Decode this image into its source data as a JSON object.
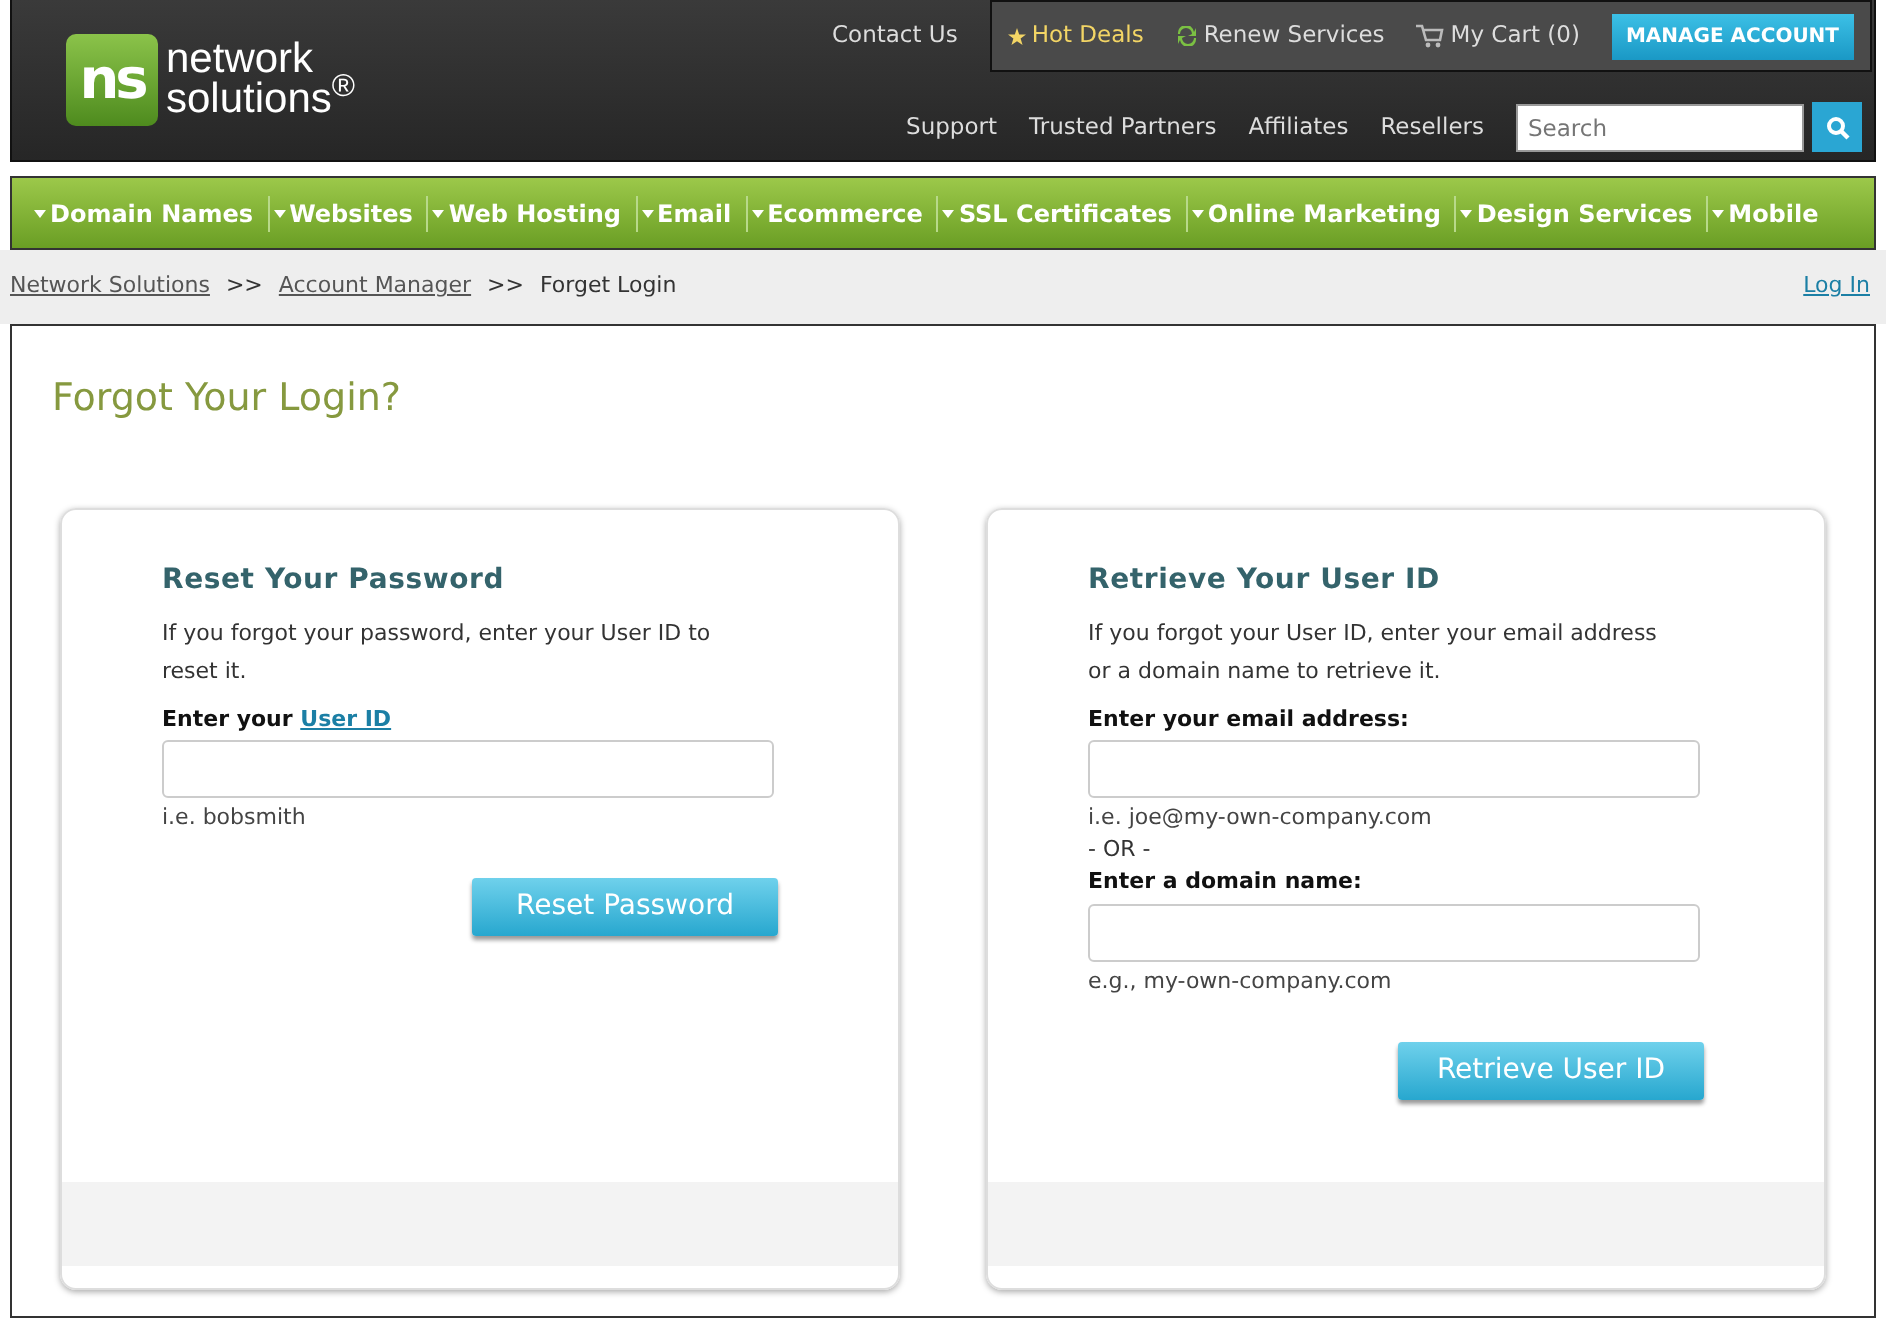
{
  "header": {
    "logo": {
      "monogram": "ns",
      "line1": "network",
      "line2": "solutions$^{®}$"
    },
    "contact": "Contact Us",
    "toolbar": [
      {
        "kind": "deals",
        "label": "Hot Deals"
      },
      {
        "kind": "renew",
        "label": "Renew Services"
      },
      {
        "kind": "cart",
        "label": "My Cart (0)"
      }
    ],
    "account_button": "MANAGE ACCOUNT",
    "links": [
      "Support",
      "Trusted Partners",
      "Affiliates",
      "Resellers"
    ],
    "search": {
      "placeholder": "Search"
    }
  },
  "nav": [
    "Domain Names",
    "Websites",
    "Web Hosting",
    "Email",
    "Ecommerce",
    "SSL Certificates",
    "Online Marketing",
    "Design Services",
    "Mobile"
  ],
  "breadcrumb": {
    "items": [
      {
        "label": "Network Solutions",
        "link": true
      },
      {
        "label": "Account Manager",
        "link": true
      },
      {
        "label": "Forget Login",
        "link": false
      }
    ],
    "separator": ">>",
    "login": "Log In"
  },
  "page_title": "Forgot Your Login?",
  "panels": [
    {
      "title": "Reset Your Password",
      "description": "If you forgot your password, enter your User ID to reset it.",
      "rows": [
        {
          "kind": "label",
          "text": "Enter your ",
          "link": "User ID"
        },
        {
          "kind": "field"
        },
        {
          "kind": "hint",
          "text": "i.e. bobsmith"
        }
      ],
      "button": "Reset Password"
    },
    {
      "title": "Retrieve Your User ID",
      "description": "If you forgot your User ID, enter your email address or a domain name to retrieve it.",
      "rows": [
        {
          "kind": "label",
          "text": "Enter your email address:"
        },
        {
          "kind": "field"
        },
        {
          "kind": "hint",
          "text": "i.e. joe@my-own-company.com"
        },
        {
          "kind": "or",
          "text": "- OR -"
        },
        {
          "kind": "label",
          "text": "Enter a domain name:"
        },
        {
          "kind": "field"
        },
        {
          "kind": "hint",
          "text": "e.g., my-own-company.com"
        }
      ],
      "button": "Retrieve User ID"
    }
  ]
}
